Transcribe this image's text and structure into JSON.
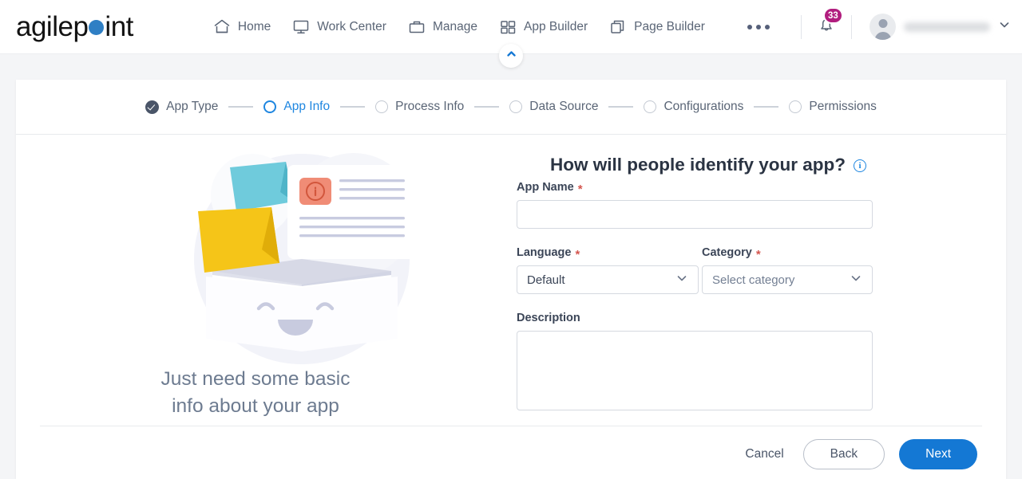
{
  "brand": {
    "name_part1": "agilep",
    "name_part2": "int",
    "dot_color": "#2f7fc4"
  },
  "topnav": {
    "items": [
      {
        "label": "Home",
        "icon": "home-icon"
      },
      {
        "label": "Work Center",
        "icon": "monitor-icon"
      },
      {
        "label": "Manage",
        "icon": "briefcase-icon"
      },
      {
        "label": "App Builder",
        "icon": "grid-icon"
      },
      {
        "label": "Page Builder",
        "icon": "copy-icon"
      }
    ],
    "more_label": "•••",
    "notification_count": "33",
    "notification_badge_color": "#b11d7e",
    "user_name": ""
  },
  "collapse": {
    "icon": "chevron-up-icon"
  },
  "stepper": {
    "steps": [
      {
        "label": "App Type",
        "state": "done"
      },
      {
        "label": "App Info",
        "state": "active"
      },
      {
        "label": "Process Info",
        "state": "idle"
      },
      {
        "label": "Data Source",
        "state": "idle"
      },
      {
        "label": "Configurations",
        "state": "idle"
      },
      {
        "label": "Permissions",
        "state": "idle"
      }
    ],
    "active_color": "#1e86e0"
  },
  "illustration": {
    "caption_line1": "Just need some basic",
    "caption_line2": "info about your app",
    "colors": {
      "teal_note": "#6fcbdc",
      "yellow_note": "#f5c518",
      "card_icon": "#f08c76",
      "box": "#c8cbdf"
    }
  },
  "form": {
    "title": "How will people identify your app?",
    "info_icon_glyph": "i",
    "app_name": {
      "label": "App Name",
      "required": "*",
      "value": "",
      "placeholder": ""
    },
    "language": {
      "label": "Language",
      "required": "*",
      "value": "Default"
    },
    "category": {
      "label": "Category",
      "required": "*",
      "value": "Select category"
    },
    "description": {
      "label": "Description",
      "value": "",
      "placeholder": ""
    }
  },
  "footer": {
    "cancel_label": "Cancel",
    "back_label": "Back",
    "next_label": "Next",
    "next_color": "#1478d4"
  }
}
